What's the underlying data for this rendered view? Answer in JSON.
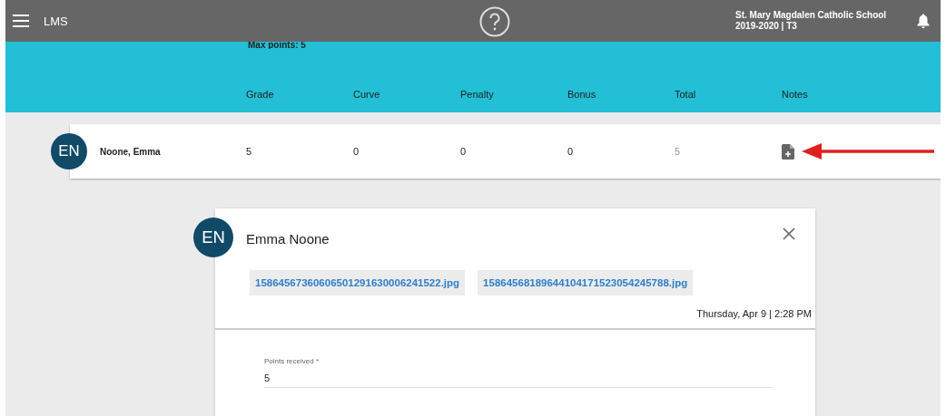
{
  "app_bar": {
    "title": "LMS",
    "school": "St. Mary Magdalen Catholic School",
    "term": "2019-2020 | T3"
  },
  "assignment": {
    "max_points": "Max points: 5"
  },
  "columns": [
    "Grade",
    "Curve",
    "Penalty",
    "Bonus",
    "Total",
    "Notes"
  ],
  "students": [
    {
      "initials": "EN",
      "name": "Noone, Emma",
      "grade": "5",
      "curve": "0",
      "penalty": "0",
      "bonus": "0",
      "total": "5"
    }
  ],
  "detail": {
    "initials": "EN",
    "name": "Emma Noone",
    "attachments": [
      "15864567360606501291630006241522.jpg",
      "15864568189644104171523054245788.jpg"
    ],
    "timestamp": "Thursday, Apr 9 | 2:28 PM",
    "field": {
      "label": "Points received *",
      "value": "5"
    }
  }
}
